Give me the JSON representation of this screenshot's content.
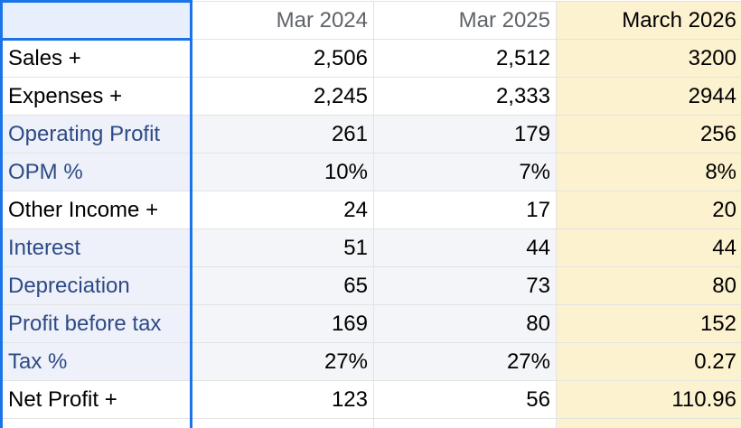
{
  "columns": [
    "Mar 2024",
    "Mar 2025",
    "March 2026"
  ],
  "rows": [
    {
      "label": "Sales +",
      "values": [
        "2,506",
        "2,512",
        "3200"
      ]
    },
    {
      "label": "Expenses +",
      "values": [
        "2,245",
        "2,333",
        "2944"
      ]
    },
    {
      "label": "Operating Profit",
      "values": [
        "261",
        "179",
        "256"
      ]
    },
    {
      "label": "OPM %",
      "values": [
        "10%",
        "7%",
        "8%"
      ]
    },
    {
      "label": "Other Income +",
      "values": [
        "24",
        "17",
        "20"
      ]
    },
    {
      "label": "Interest",
      "values": [
        "51",
        "44",
        "44"
      ]
    },
    {
      "label": "Depreciation",
      "values": [
        "65",
        "73",
        "80"
      ]
    },
    {
      "label": "Profit before tax",
      "values": [
        "169",
        "80",
        "152"
      ]
    },
    {
      "label": "Tax %",
      "values": [
        "27%",
        "27%",
        "0.27"
      ]
    },
    {
      "label": "Net Profit +",
      "values": [
        "123",
        "56",
        "110.96"
      ]
    }
  ],
  "colors": {
    "selection": "#1a73e8",
    "highlight_column": "#fdf2d0"
  }
}
